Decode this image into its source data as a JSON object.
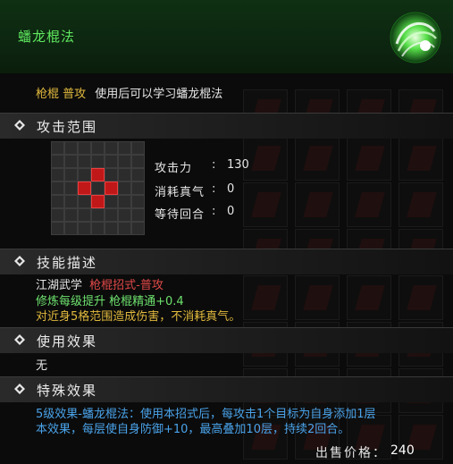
{
  "skill": {
    "name": "蟠龙棍法",
    "icon": "green-swirl-skill-icon",
    "type_tag": "枪棍 普攻",
    "type_desc": "使用后可以学习蟠龙棍法"
  },
  "sections": {
    "range_title": "攻击范围",
    "desc_title": "技能描述",
    "use_title": "使用效果",
    "special_title": "特殊效果"
  },
  "range_grid": {
    "cols": 7,
    "rows": 7,
    "active": [
      [
        3,
        2
      ],
      [
        2,
        3
      ],
      [
        4,
        3
      ],
      [
        3,
        4
      ]
    ]
  },
  "stats": [
    {
      "label": "攻击力",
      "value": "130"
    },
    {
      "label": "消耗真气",
      "value": "0"
    },
    {
      "label": "等待回合",
      "value": "0"
    }
  ],
  "description": {
    "category_prefix": "江湖武学",
    "category_type": "枪棍招式-普攻",
    "training_line": "修炼每级提升 枪棍精通+0.4",
    "effect_line": "对近身5格范围造成伤害，不消耗真气。"
  },
  "use_effect": "无",
  "special_effect": {
    "line1": "5级效果-蟠龙棍法：使用本招式后，每攻击1个目标为自身添加1层",
    "line2": "本效果，每层使自身防御+10，最高叠加10层，持续2回合。"
  },
  "price": {
    "label": "出售价格：",
    "value": "240"
  },
  "colors": {
    "name_green": "#5fe85f",
    "tag_gold": "#e0b93d",
    "category_red": "#e14848",
    "training_green": "#6ee26e",
    "special_blue": "#4aa3ea"
  }
}
